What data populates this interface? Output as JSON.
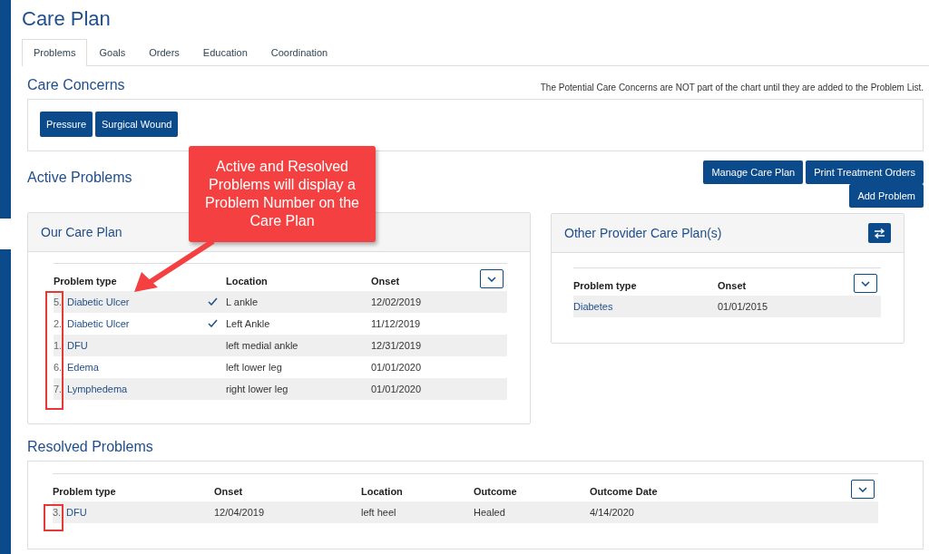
{
  "title": "Care Plan",
  "tabs": [
    {
      "label": "Problems",
      "selected": true
    },
    {
      "label": "Goals",
      "selected": false
    },
    {
      "label": "Orders",
      "selected": false
    },
    {
      "label": "Education",
      "selected": false
    },
    {
      "label": "Coordination",
      "selected": false
    }
  ],
  "care_concerns": {
    "title": "Care Concerns",
    "note": "The Potential Care Concerns are NOT part of the chart until they are added to the Problem List.",
    "buttons": [
      "Pressure",
      "Surgical Wound"
    ]
  },
  "active_problems": {
    "title": "Active Problems",
    "buttons": [
      "Manage Care Plan",
      "Print Treatment Orders",
      "Add Problem"
    ]
  },
  "our_care_plan": {
    "title": "Our Care Plan",
    "columns": [
      "Problem type",
      "Location",
      "Onset"
    ],
    "rows": [
      {
        "number": "5.",
        "problem": "Diabetic Ulcer",
        "checked": true,
        "location": "L ankle",
        "onset": "12/02/2019"
      },
      {
        "number": "2.",
        "problem": "Diabetic Ulcer",
        "checked": true,
        "location": "Left Ankle",
        "onset": "11/12/2019"
      },
      {
        "number": "1.",
        "problem": "DFU",
        "checked": false,
        "location": "left medial ankle",
        "onset": "12/31/2019"
      },
      {
        "number": "6.",
        "problem": "Edema",
        "checked": false,
        "location": "left lower leg",
        "onset": "01/01/2020"
      },
      {
        "number": "7.",
        "problem": "Lymphedema",
        "checked": false,
        "location": "right lower leg",
        "onset": "01/01/2020"
      }
    ]
  },
  "other_provider": {
    "title": "Other Provider Care Plan(s)",
    "columns": [
      "Problem type",
      "Onset"
    ],
    "rows": [
      {
        "problem": "Diabetes",
        "onset": "01/01/2015"
      }
    ]
  },
  "resolved_problems": {
    "title": "Resolved Problems",
    "columns": [
      "Problem type",
      "Onset",
      "Location",
      "Outcome",
      "Outcome Date"
    ],
    "rows": [
      {
        "number": "3.",
        "problem": "DFU",
        "onset": "12/04/2019",
        "location": "left heel",
        "outcome": "Healed",
        "outcome_date": "4/14/2020"
      }
    ]
  },
  "callout": "Active and Resolved Problems will display a Problem Number on the Care Plan"
}
